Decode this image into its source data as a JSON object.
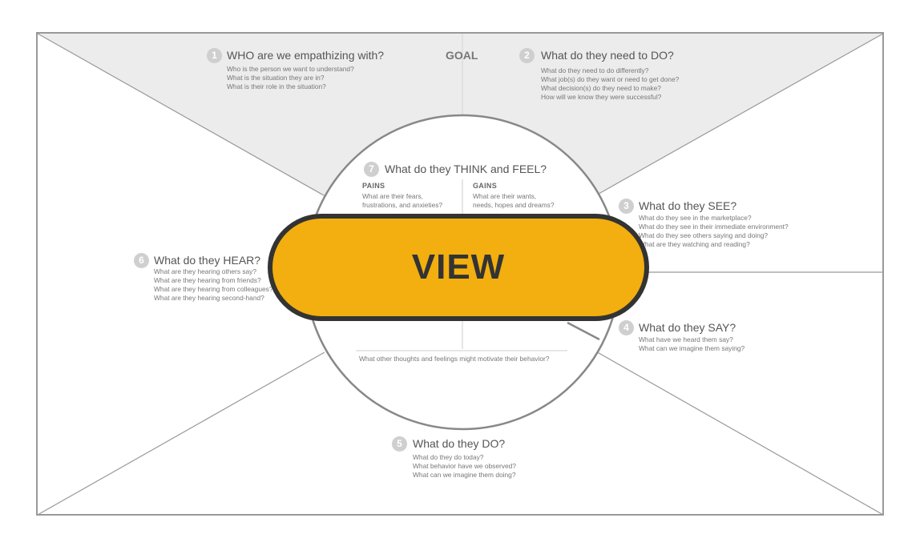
{
  "goal_label": "GOAL",
  "view_label": "VIEW",
  "sections": {
    "who": {
      "number": "1",
      "title": "WHO are we empathizing with?",
      "questions": [
        "Who is the person we want to understand?",
        "What is the situation they are in?",
        "What is their role in the situation?"
      ]
    },
    "do_need": {
      "number": "2",
      "title": "What do they need to DO?",
      "questions": [
        "What do they need to do differently?",
        "What job(s) do they want or need to get done?",
        "What decision(s) do they need to make?",
        "How will we know they were successful?"
      ]
    },
    "see": {
      "number": "3",
      "title": "What do they SEE?",
      "questions": [
        "What do they see in the marketplace?",
        "What do they see in their immediate environment?",
        "What do they see others saying and doing?",
        "What are they watching and reading?"
      ]
    },
    "say": {
      "number": "4",
      "title": "What do they SAY?",
      "questions": [
        "What have we heard them say?",
        "What can we imagine them saying?"
      ]
    },
    "do": {
      "number": "5",
      "title": "What do they DO?",
      "questions": [
        "What do they do today?",
        "What behavior have we observed?",
        "What can we imagine them doing?"
      ]
    },
    "hear": {
      "number": "6",
      "title": "What do they HEAR?",
      "questions": [
        "What are they hearing others say?",
        "What are they hearing from friends?",
        "What are they hearing from colleagues?",
        "What are they hearing second-hand?"
      ]
    },
    "think_feel": {
      "number": "7",
      "title": "What do they THINK and FEEL?",
      "pains_label": "PAINS",
      "pains_questions": [
        "What are their fears,",
        "frustrations, and anxieties?"
      ],
      "gains_label": "GAINS",
      "gains_questions": [
        "What are their wants,",
        "needs, hopes and dreams?"
      ],
      "footer": "What other thoughts and feelings might motivate their behavior?"
    }
  },
  "colors": {
    "button_fill": "#f2af0f",
    "button_border": "#333333",
    "top_area": "#ececec",
    "lines": "#999999"
  }
}
